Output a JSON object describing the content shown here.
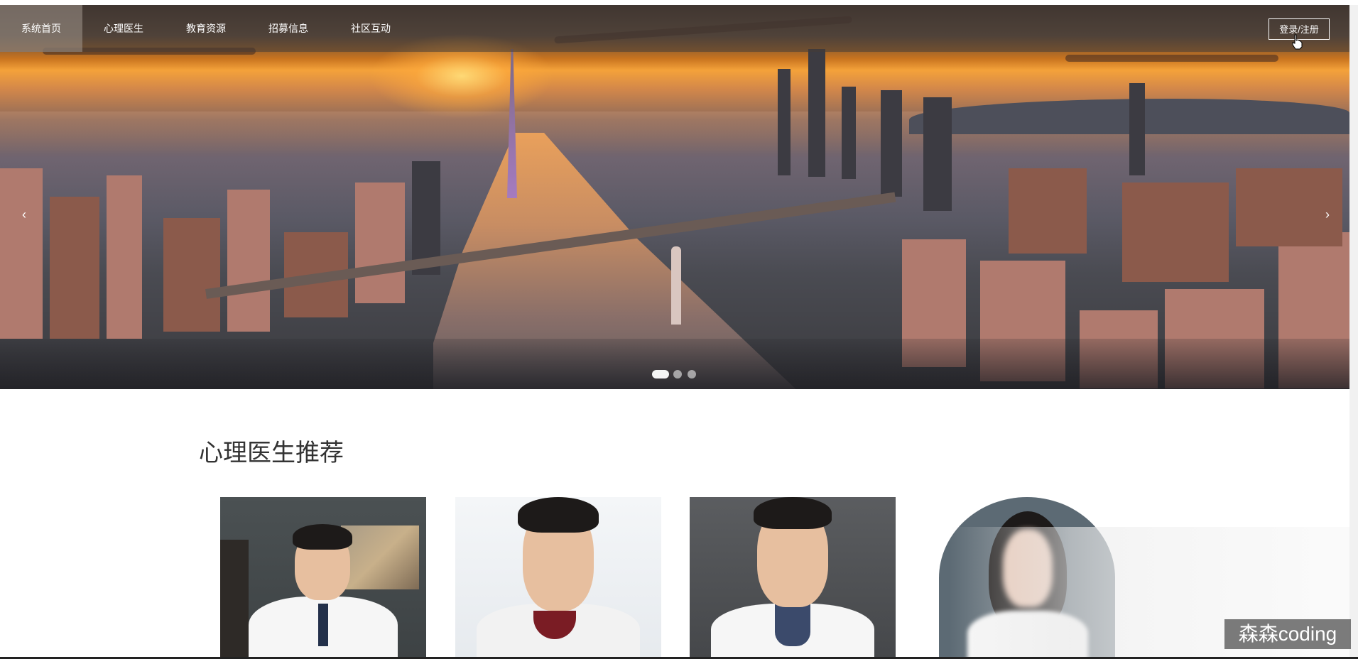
{
  "nav": {
    "items": [
      {
        "label": "系统首页",
        "active": true
      },
      {
        "label": "心理医生",
        "active": false
      },
      {
        "label": "教育资源",
        "active": false
      },
      {
        "label": "招募信息",
        "active": false
      },
      {
        "label": "社区互动",
        "active": false
      }
    ],
    "login_label": "登录/注册"
  },
  "banner": {
    "prev_glyph": "‹",
    "next_glyph": "›",
    "slide_count": 3,
    "active_slide": 1
  },
  "section": {
    "title": "心理医生推荐"
  },
  "doctors": [
    {
      "photo": "doctor-photo-1"
    },
    {
      "photo": "doctor-photo-2"
    },
    {
      "photo": "doctor-photo-3"
    },
    {
      "photo": "doctor-photo-4"
    }
  ],
  "watermark": "森森coding",
  "icons": {
    "cursor": "hand-pointer-icon",
    "prev": "chevron-left-icon",
    "next": "chevron-right-icon"
  },
  "colors": {
    "nav_overlay": "#463c37",
    "text_white": "#ffffff",
    "title_text": "#333333"
  }
}
